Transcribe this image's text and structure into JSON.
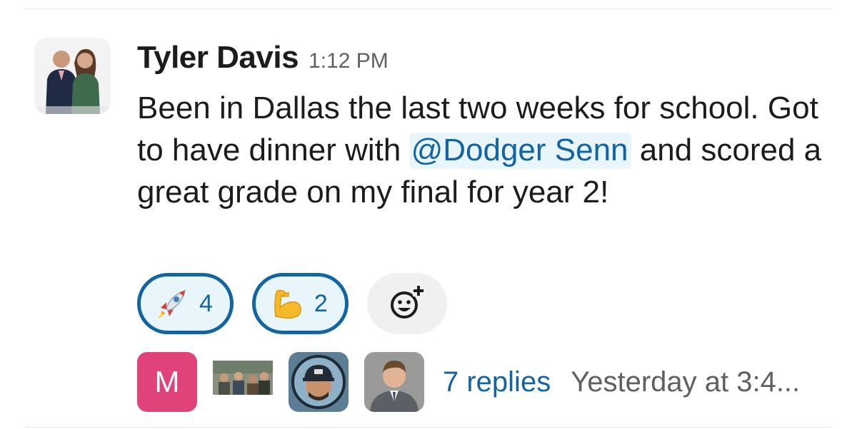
{
  "message": {
    "author": "Tyler Davis",
    "timestamp": "1:12 PM",
    "text_before_mention": "Been in Dallas the last two weeks for school. Got to have dinner with ",
    "mention": "@Dodger Senn",
    "text_after_mention": " and scored a great grade on my final for year 2!"
  },
  "reactions": [
    {
      "emoji": "rocket-icon",
      "count": "4"
    },
    {
      "emoji": "flexed-biceps-icon",
      "count": "2"
    }
  ],
  "add_reaction_icon": "add-emoji-icon",
  "thread": {
    "avatar_m_letter": "M",
    "replies_label": "7 replies",
    "last_reply": "Yesterday at 3:4..."
  },
  "colors": {
    "link": "#1264a3",
    "mention_bg": "#e8f5fa",
    "text": "#1d1c1d",
    "muted": "#616061",
    "avatar_m_bg": "#e0437a"
  }
}
